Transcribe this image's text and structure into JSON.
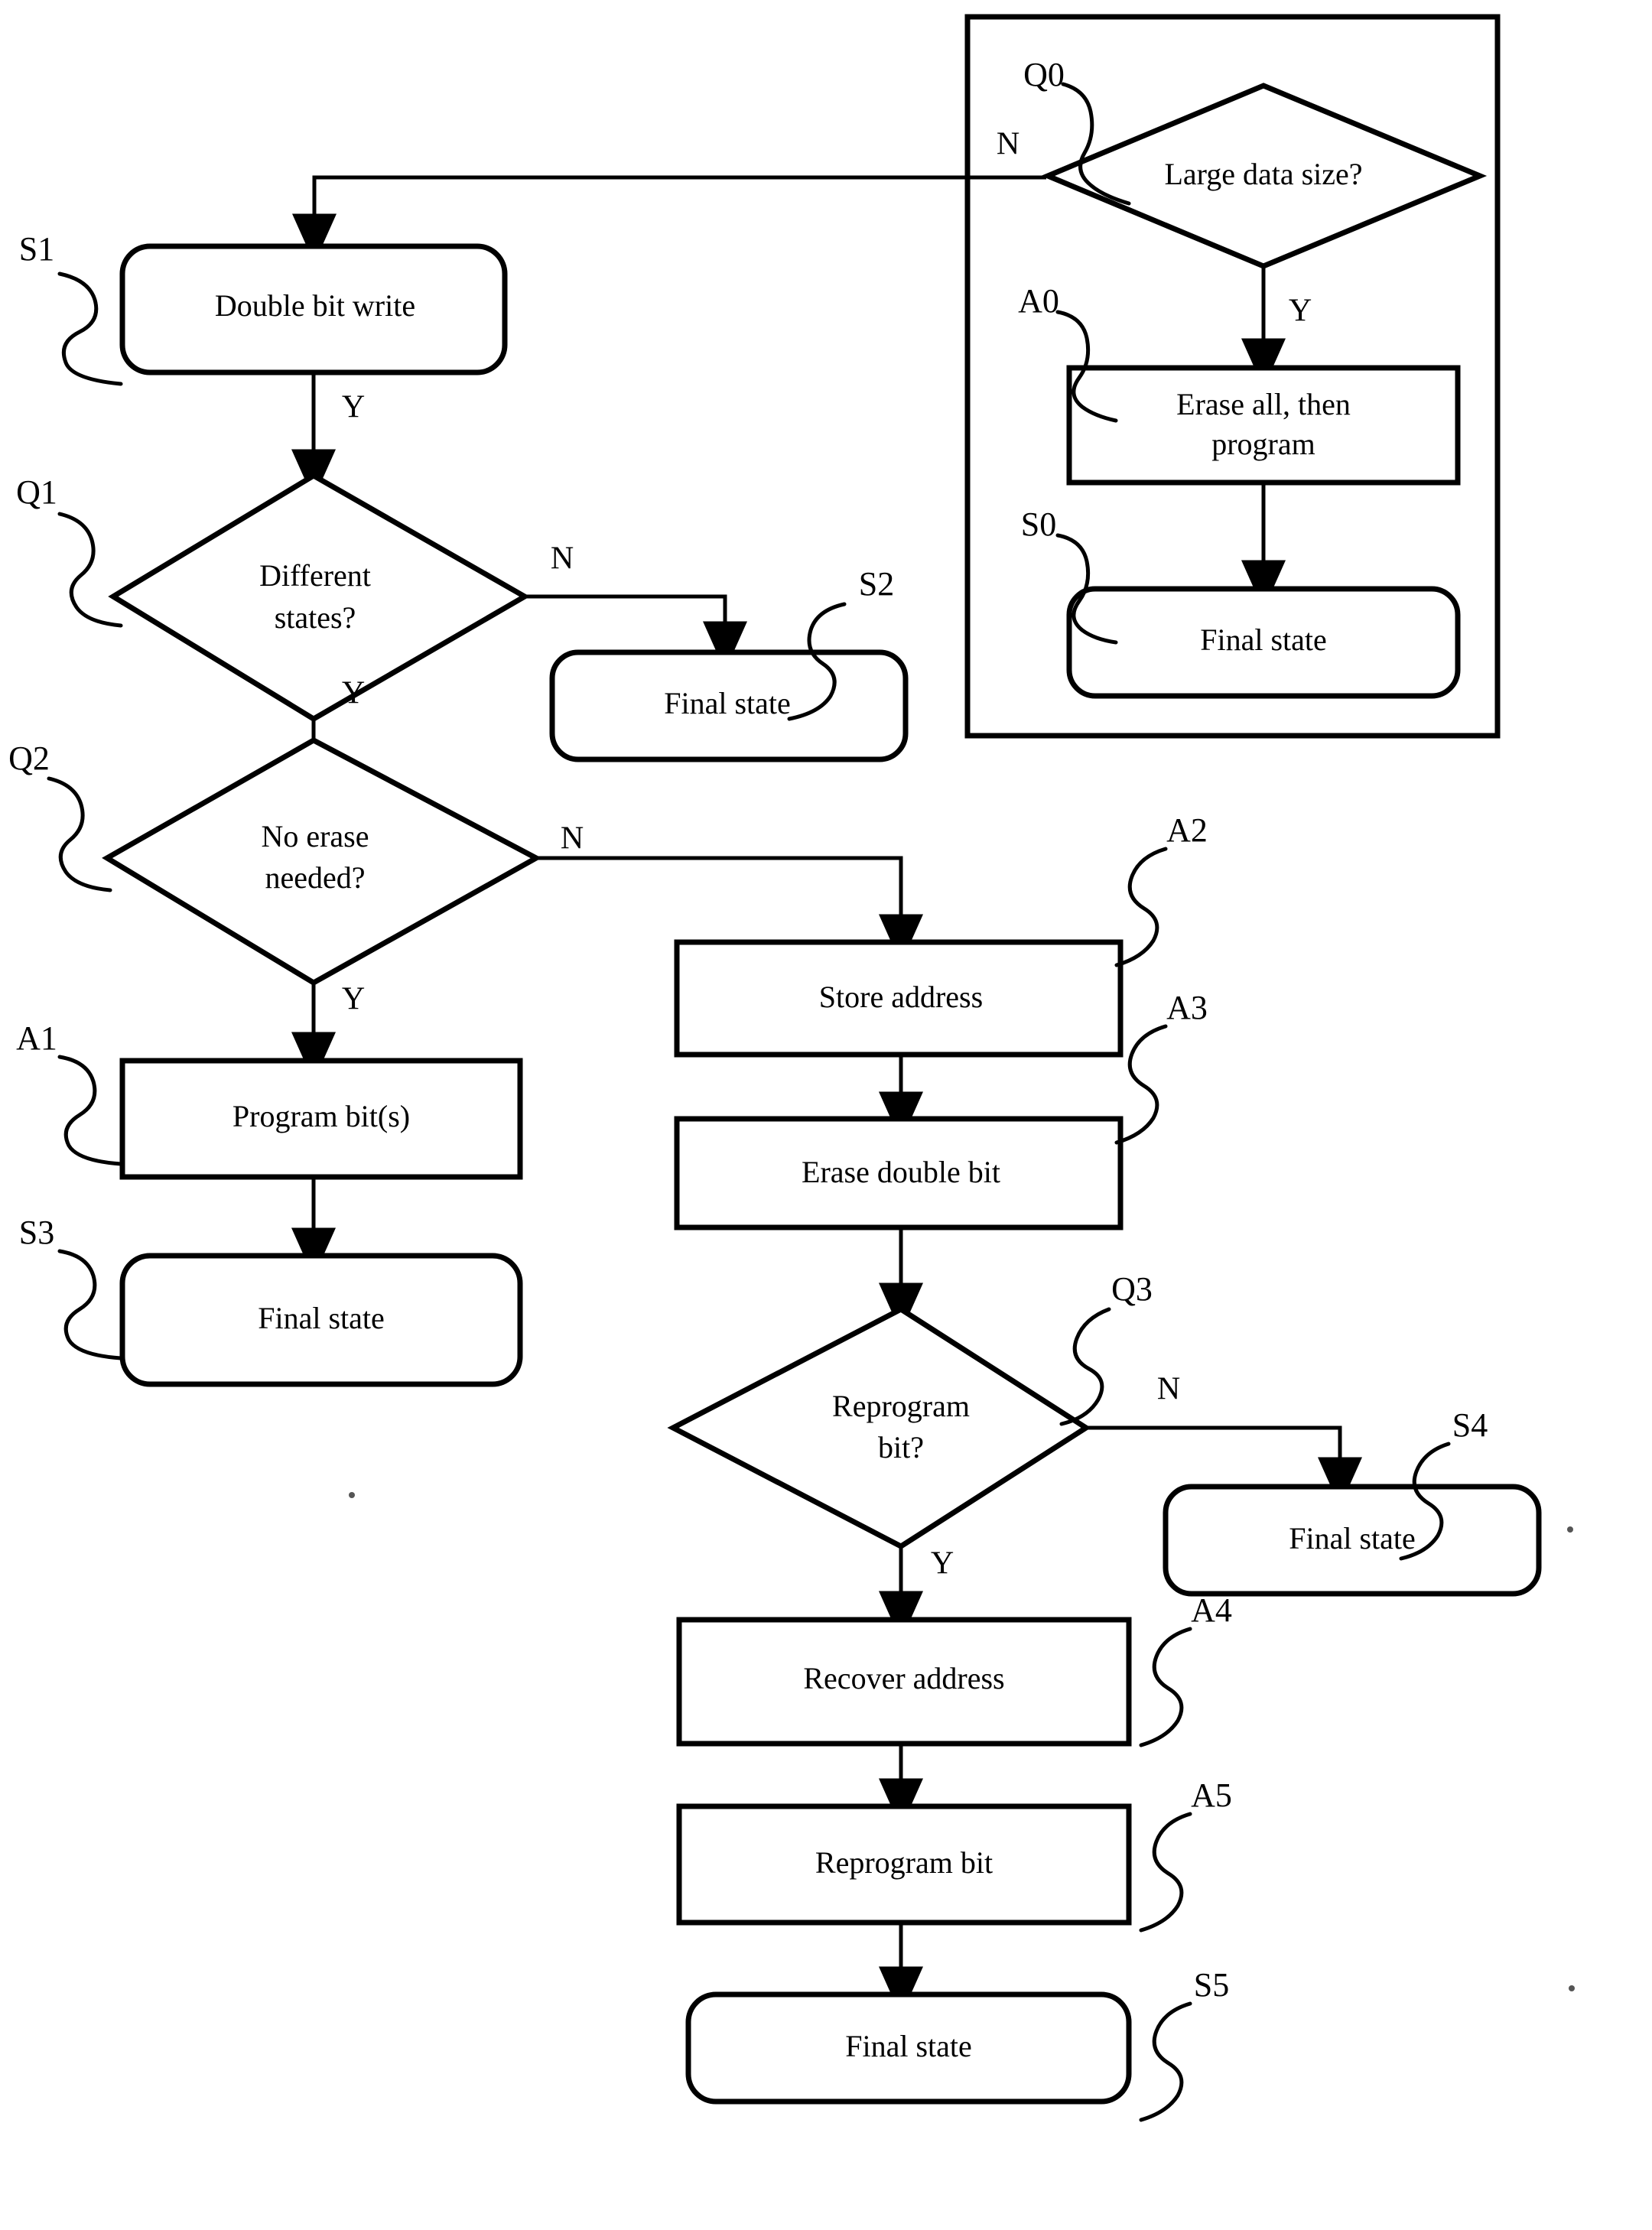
{
  "diagram": {
    "type": "flowchart",
    "title": "",
    "nodes": [
      {
        "id": "Q0",
        "ref": "Q0",
        "shape": "diamond",
        "text": "Large data size?"
      },
      {
        "id": "A0",
        "ref": "A0",
        "shape": "rect",
        "text_line1": "Erase all, then",
        "text_line2": "program"
      },
      {
        "id": "S0",
        "ref": "S0",
        "shape": "rounded",
        "text": "Final state"
      },
      {
        "id": "S1",
        "ref": "S1",
        "shape": "rounded",
        "text": "Double bit write"
      },
      {
        "id": "Q1",
        "ref": "Q1",
        "shape": "diamond",
        "text_line1": "Different",
        "text_line2": "states?"
      },
      {
        "id": "S2",
        "ref": "S2",
        "shape": "rounded",
        "text": "Final state"
      },
      {
        "id": "Q2",
        "ref": "Q2",
        "shape": "diamond",
        "text_line1": "No erase",
        "text_line2": "needed?"
      },
      {
        "id": "A1",
        "ref": "A1",
        "shape": "rect",
        "text": "Program bit(s)"
      },
      {
        "id": "S3",
        "ref": "S3",
        "shape": "rounded",
        "text": "Final state"
      },
      {
        "id": "A2",
        "ref": "A2",
        "shape": "rect",
        "text": "Store address"
      },
      {
        "id": "A3",
        "ref": "A3",
        "shape": "rect",
        "text": "Erase double bit"
      },
      {
        "id": "Q3",
        "ref": "Q3",
        "shape": "diamond",
        "text_line1": "Reprogram",
        "text_line2": "bit?"
      },
      {
        "id": "S4",
        "ref": "S4",
        "shape": "rounded",
        "text": "Final state"
      },
      {
        "id": "A4",
        "ref": "A4",
        "shape": "rect",
        "text": "Recover address"
      },
      {
        "id": "A5",
        "ref": "A5",
        "shape": "rect",
        "text": "Reprogram bit"
      },
      {
        "id": "S5",
        "ref": "S5",
        "shape": "rounded",
        "text": "Final state"
      }
    ],
    "branch_labels": {
      "q0_no": "N",
      "q0_yes": "Y",
      "s1_yes": "Y",
      "q1_no": "N",
      "q1_yes": "Y",
      "q2_no": "N",
      "q2_yes": "Y",
      "q3_no": "N",
      "q3_yes": "Y"
    },
    "colors": {
      "stroke": "#000000",
      "fill": "#ffffff"
    }
  }
}
